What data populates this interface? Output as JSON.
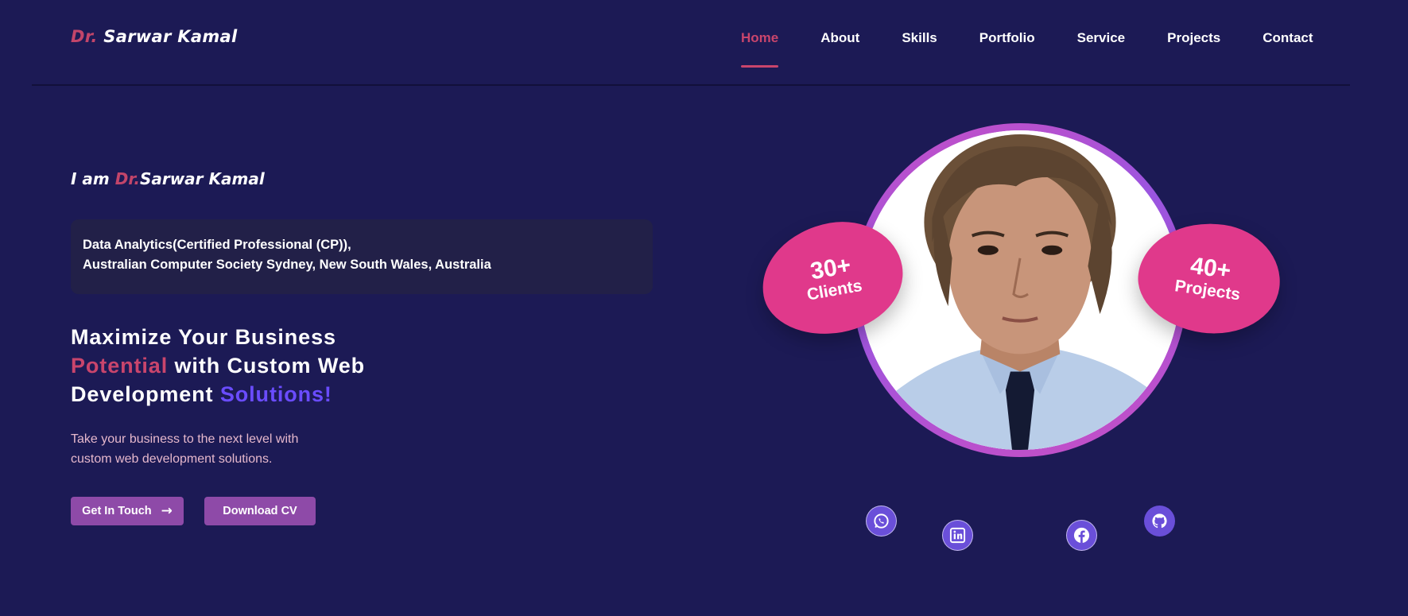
{
  "nav": {
    "logo_prefix": "Dr.",
    "logo_name": "Sarwar Kamal",
    "links": [
      {
        "label": "Home",
        "active": true
      },
      {
        "label": "About",
        "active": false
      },
      {
        "label": "Skills",
        "active": false
      },
      {
        "label": "Portfolio",
        "active": false
      },
      {
        "label": "Service",
        "active": false
      },
      {
        "label": "Projects",
        "active": false
      },
      {
        "label": "Contact",
        "active": false
      }
    ]
  },
  "hero": {
    "intro_prefix": "I am",
    "intro_title": "Dr.",
    "intro_name": "Sarwar Kamal",
    "credential_line1": "Data Analytics(Certified Professional (CP)),",
    "credential_line2": "Australian Computer Society Sydney, New South Wales, Australia",
    "headline": {
      "part1": "Maximize Your Business",
      "highlight1": "Potential",
      "part2": " with Custom Web",
      "part3": "Development ",
      "highlight2": "Solutions!"
    },
    "subtext": "Take your business to the next level with custom web development solutions.",
    "buttons": {
      "get_in_touch": "Get In Touch",
      "get_in_touch_icon": "→",
      "download_cv": "Download CV"
    }
  },
  "stats": {
    "clients_value": "30+",
    "clients_label": "Clients",
    "projects_value": "40+",
    "projects_label": "Projects"
  },
  "social": [
    {
      "icon": "whatsapp-icon"
    },
    {
      "icon": "linkedin-icon"
    },
    {
      "icon": "facebook-icon"
    },
    {
      "icon": "github-icon"
    }
  ],
  "colors": {
    "background": "#1c1a55",
    "accent_pink": "#c9456c",
    "accent_purple": "#6a4cff",
    "button": "#8e4aa8",
    "blob": "#e0398b"
  }
}
